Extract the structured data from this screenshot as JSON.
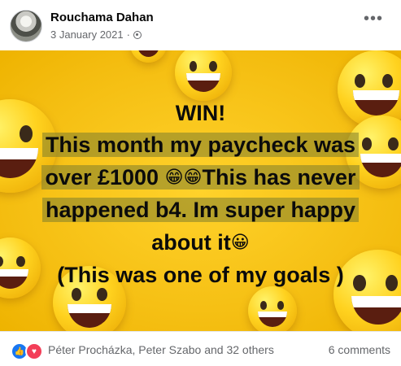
{
  "post": {
    "author": "Rouchama Dahan",
    "date": "3 January 2021",
    "separator": "·",
    "more_label": "•••",
    "privacy_icon": "globe-icon"
  },
  "image": {
    "background_color": "#f4bd10",
    "line1": "WIN!",
    "line2": "This month my paycheck was",
    "line3_a": "over £1000",
    "line3_emoji_1": "😁",
    "line3_emoji_2": "😁",
    "line3_b": "This has never",
    "line4": "happened b4. Im super happy",
    "line5_a": "about it",
    "line5_emoji": "😀",
    "line6": "(This was one of my goals )"
  },
  "reactions": {
    "icons": [
      "like-icon",
      "love-icon"
    ],
    "names": "Péter Procházka, Peter Szabo and 32 others",
    "comments": "6 comments",
    "like_color": "#1877f2",
    "love_color": "#f33e58"
  }
}
